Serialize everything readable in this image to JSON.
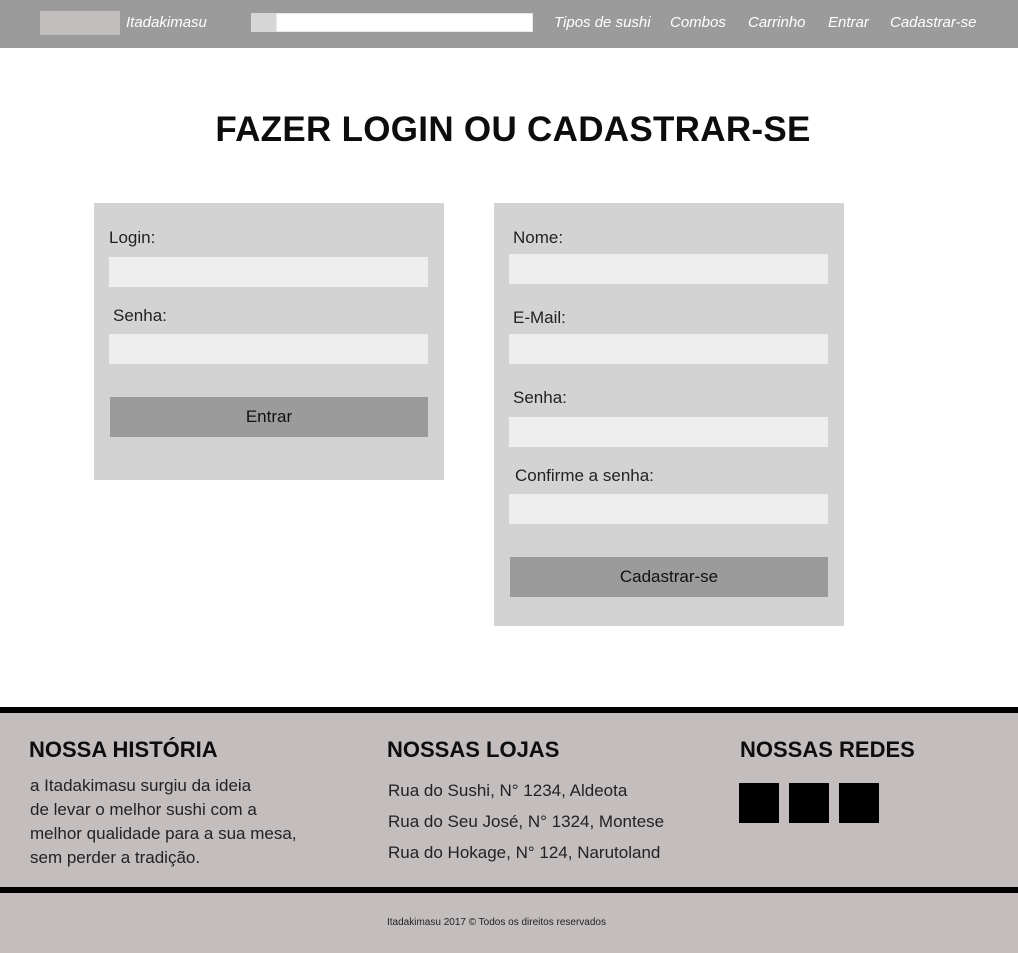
{
  "header": {
    "brand": "Itadakimasu",
    "nav": [
      "Tipos de sushi",
      "Combos",
      "Carrinho",
      "Entrar",
      "Cadastrar-se"
    ]
  },
  "title": "FAZER LOGIN OU CADASTRAR-SE",
  "login_form": {
    "login_label": "Login:",
    "password_label": "Senha:",
    "submit_label": "Entrar"
  },
  "signup_form": {
    "name_label": "Nome:",
    "email_label": "E-Mail:",
    "password_label": "Senha:",
    "confirm_label": "Confirme a senha:",
    "submit_label": "Cadastrar-se"
  },
  "footer": {
    "history": {
      "heading": "NOSSA HISTÓRIA",
      "lines": [
        "a Itadakimasu surgiu da ideia",
        "de levar o melhor sushi com a",
        "melhor qualidade para a sua mesa,",
        "sem perder a tradição."
      ]
    },
    "stores": {
      "heading": "NOSSAS LOJAS",
      "items": [
        "Rua do Sushi, N° 1234, Aldeota",
        "Rua do Seu José, N° 1324, Montese",
        "Rua do Hokage, N° 124, Narutoland"
      ]
    },
    "social": {
      "heading": "NOSSAS REDES"
    },
    "copyright": "Itadakimasu 2017  © Todos os direitos reservados"
  }
}
